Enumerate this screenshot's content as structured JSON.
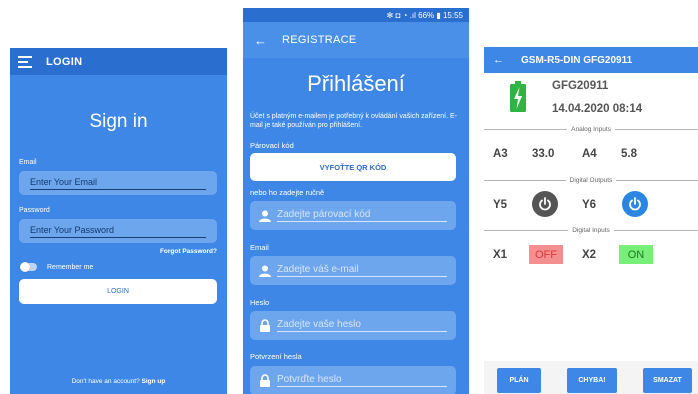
{
  "login": {
    "title": "LOGIN",
    "heading": "Sign in",
    "email_label": "Email",
    "email_placeholder": "Enter Your Email",
    "password_label": "Password",
    "password_placeholder": "Enter Your Password",
    "forgot": "Forgot Password?",
    "remember": "Remember me",
    "login_button": "LOGIN",
    "footer_text": "Don't have an account?",
    "signup": "Sign up"
  },
  "register": {
    "status": "✻ ◘ ◔ .ıl 66% ▮ 15:55",
    "title": "REGISTRACE",
    "heading": "Přihlášení",
    "description": "Účet s platným e-mailem je potřebný k ovládání vašich zařízení. E-mail je také používán pro přihlášení.",
    "pairing_label": "Párovací kód",
    "qr_button": "VYFOŤTE QR KÓD",
    "manual_label": "nebo ho zadejte ručně",
    "pairing_placeholder": "Zadejte párovací kód",
    "email_label": "Email",
    "email_placeholder": "Zadejte váš e-mail",
    "password_label": "Heslo",
    "password_placeholder": "Zadejte vaše heslo",
    "confirm_label": "Potvrzení hesla",
    "confirm_placeholder": "Potvrďte heslo"
  },
  "gsm": {
    "title": "GSM-R5-DIN GFG20911",
    "device_name": "GFG20911",
    "datetime": "14.04.2020 08:14",
    "analog_header": "Analog Inputs",
    "analog": [
      {
        "name": "A3",
        "value": "33.0"
      },
      {
        "name": "A4",
        "value": "5.8"
      }
    ],
    "outputs_header": "Digital Outputs",
    "outputs": [
      {
        "name": "Y5",
        "state": "off"
      },
      {
        "name": "Y6",
        "state": "on"
      }
    ],
    "digital_header": "Digital Inputs",
    "inputs": [
      {
        "name": "X1",
        "state": "OFF"
      },
      {
        "name": "X2",
        "state": "ON"
      }
    ],
    "buttons": {
      "plan": "PLÁN",
      "errors": "CHYBA!",
      "delete": "SMAZAT"
    },
    "colors": {
      "off": "#f48f8f",
      "on": "#78ef78",
      "out_off": "#555555",
      "out_on": "#2a86e0",
      "battery": "#2fb344"
    }
  }
}
